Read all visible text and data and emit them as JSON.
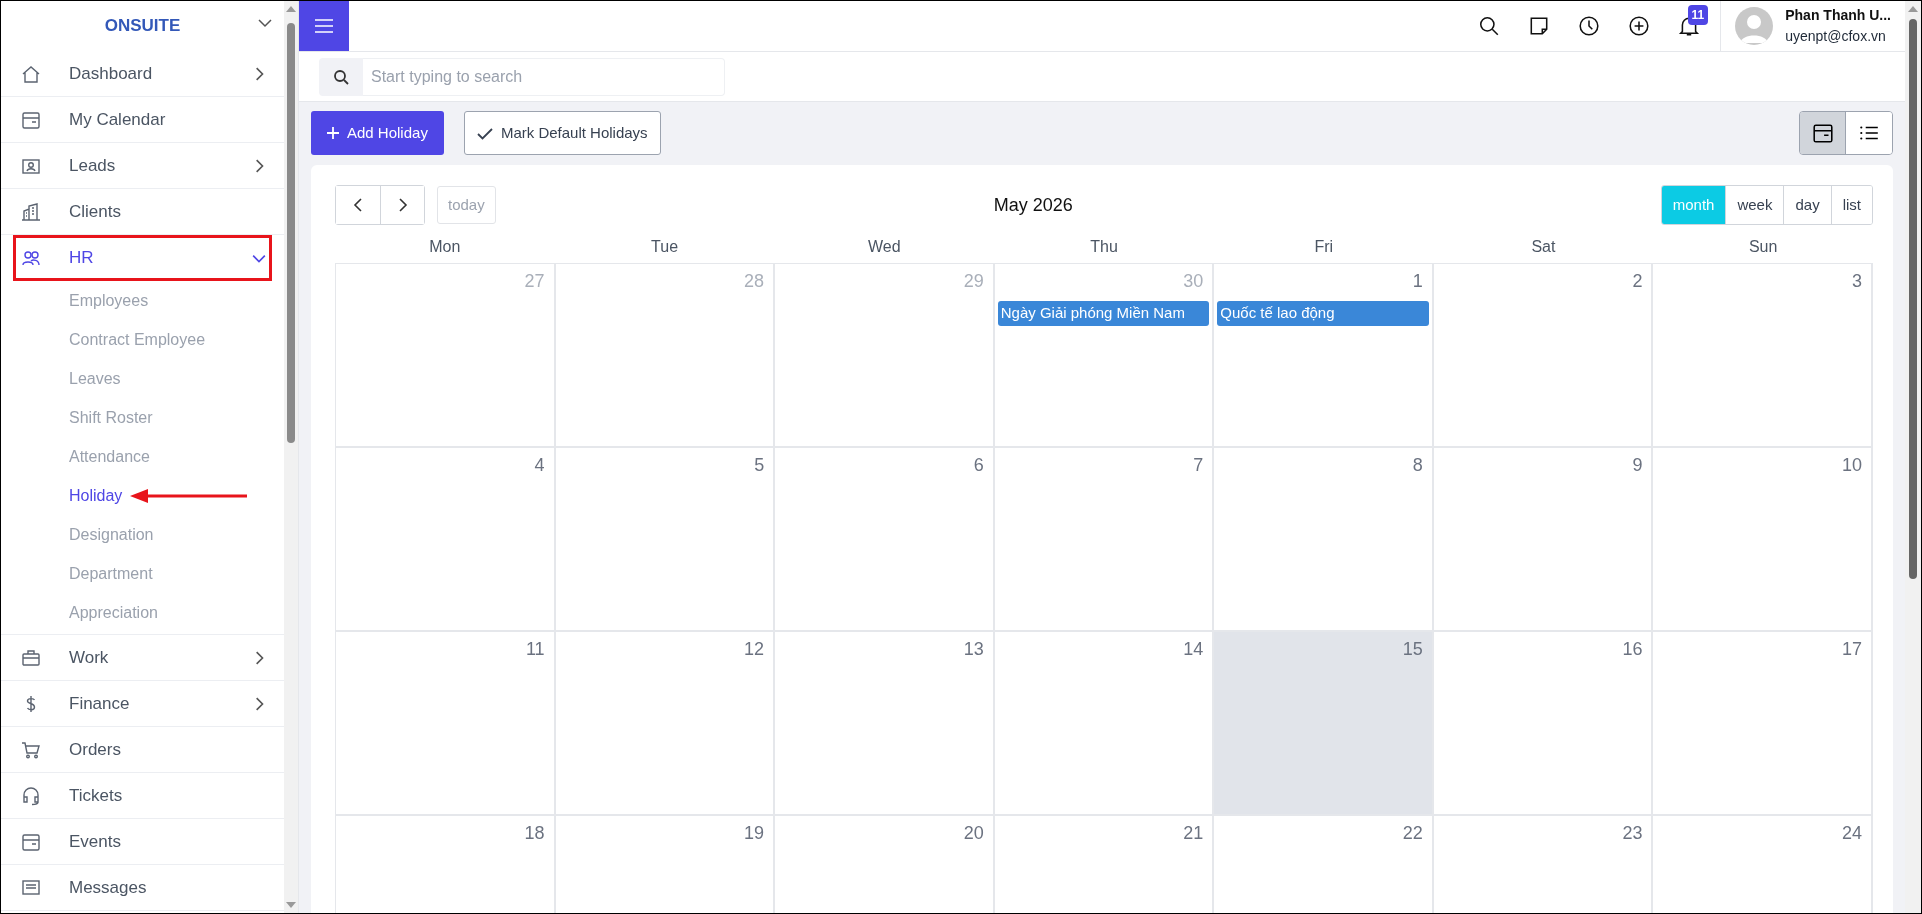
{
  "brand": "ONSUITE",
  "sidebar": {
    "items": [
      {
        "label": "Dashboard",
        "has_submenu": true,
        "expanded": false,
        "highlighted": false
      },
      {
        "label": "My Calendar",
        "has_submenu": false,
        "expanded": false,
        "highlighted": false
      },
      {
        "label": "Leads",
        "has_submenu": true,
        "expanded": false,
        "highlighted": false
      },
      {
        "label": "Clients",
        "has_submenu": false,
        "expanded": false,
        "highlighted": false
      },
      {
        "label": "HR",
        "has_submenu": true,
        "expanded": true,
        "highlighted": true,
        "children": [
          {
            "label": "Employees",
            "selected": false,
            "pointed": false
          },
          {
            "label": "Contract Employee",
            "selected": false,
            "pointed": false
          },
          {
            "label": "Leaves",
            "selected": false,
            "pointed": false
          },
          {
            "label": "Shift Roster",
            "selected": false,
            "pointed": false
          },
          {
            "label": "Attendance",
            "selected": false,
            "pointed": false
          },
          {
            "label": "Holiday",
            "selected": true,
            "pointed": true
          },
          {
            "label": "Designation",
            "selected": false,
            "pointed": false
          },
          {
            "label": "Department",
            "selected": false,
            "pointed": false
          },
          {
            "label": "Appreciation",
            "selected": false,
            "pointed": false
          }
        ]
      },
      {
        "label": "Work",
        "has_submenu": true,
        "expanded": false,
        "highlighted": false
      },
      {
        "label": "Finance",
        "has_submenu": true,
        "expanded": false,
        "highlighted": false
      },
      {
        "label": "Orders",
        "has_submenu": false,
        "expanded": false,
        "highlighted": false
      },
      {
        "label": "Tickets",
        "has_submenu": false,
        "expanded": false,
        "highlighted": false
      },
      {
        "label": "Events",
        "has_submenu": false,
        "expanded": false,
        "highlighted": false
      },
      {
        "label": "Messages",
        "has_submenu": false,
        "expanded": false,
        "highlighted": false
      }
    ]
  },
  "topbar": {
    "notification_count": "11",
    "user_name": "Phan Thanh U...",
    "user_email": "uyenpt@cfox.vn"
  },
  "search": {
    "placeholder": "Start typing to search"
  },
  "toolbar": {
    "add_button": "Add Holiday",
    "mark_button": "Mark Default Holidays",
    "views": [
      {
        "selected": true
      },
      {
        "selected": false
      }
    ]
  },
  "calendar": {
    "title": "May 2026",
    "today_button": "today",
    "view_buttons": [
      {
        "label": "month",
        "selected": true
      },
      {
        "label": "week",
        "selected": false
      },
      {
        "label": "day",
        "selected": false
      },
      {
        "label": "list",
        "selected": false
      }
    ],
    "weekdays": [
      "Mon",
      "Tue",
      "Wed",
      "Thu",
      "Fri",
      "Sat",
      "Sun"
    ],
    "weeks": [
      [
        {
          "label": "27",
          "muted": true,
          "today": false
        },
        {
          "label": "28",
          "muted": true,
          "today": false
        },
        {
          "label": "29",
          "muted": true,
          "today": false
        },
        {
          "label": "30",
          "muted": true,
          "today": false,
          "events": [
            "Ngày Giải phóng Miền Nam"
          ]
        },
        {
          "label": "1",
          "muted": false,
          "today": false,
          "events": [
            "Quốc tế lao động"
          ]
        },
        {
          "label": "2",
          "muted": false,
          "today": false
        },
        {
          "label": "3",
          "muted": false,
          "today": false
        }
      ],
      [
        {
          "label": "4",
          "muted": false,
          "today": false
        },
        {
          "label": "5",
          "muted": false,
          "today": false
        },
        {
          "label": "6",
          "muted": false,
          "today": false
        },
        {
          "label": "7",
          "muted": false,
          "today": false
        },
        {
          "label": "8",
          "muted": false,
          "today": false
        },
        {
          "label": "9",
          "muted": false,
          "today": false
        },
        {
          "label": "10",
          "muted": false,
          "today": false
        }
      ],
      [
        {
          "label": "11",
          "muted": false,
          "today": false
        },
        {
          "label": "12",
          "muted": false,
          "today": false
        },
        {
          "label": "13",
          "muted": false,
          "today": false
        },
        {
          "label": "14",
          "muted": false,
          "today": false
        },
        {
          "label": "15",
          "muted": false,
          "today": true
        },
        {
          "label": "16",
          "muted": false,
          "today": false
        },
        {
          "label": "17",
          "muted": false,
          "today": false
        }
      ],
      [
        {
          "label": "18",
          "muted": false,
          "today": false
        },
        {
          "label": "19",
          "muted": false,
          "today": false
        },
        {
          "label": "20",
          "muted": false,
          "today": false
        },
        {
          "label": "21",
          "muted": false,
          "today": false
        },
        {
          "label": "22",
          "muted": false,
          "today": false
        },
        {
          "label": "23",
          "muted": false,
          "today": false
        },
        {
          "label": "24",
          "muted": false,
          "today": false
        }
      ]
    ]
  }
}
